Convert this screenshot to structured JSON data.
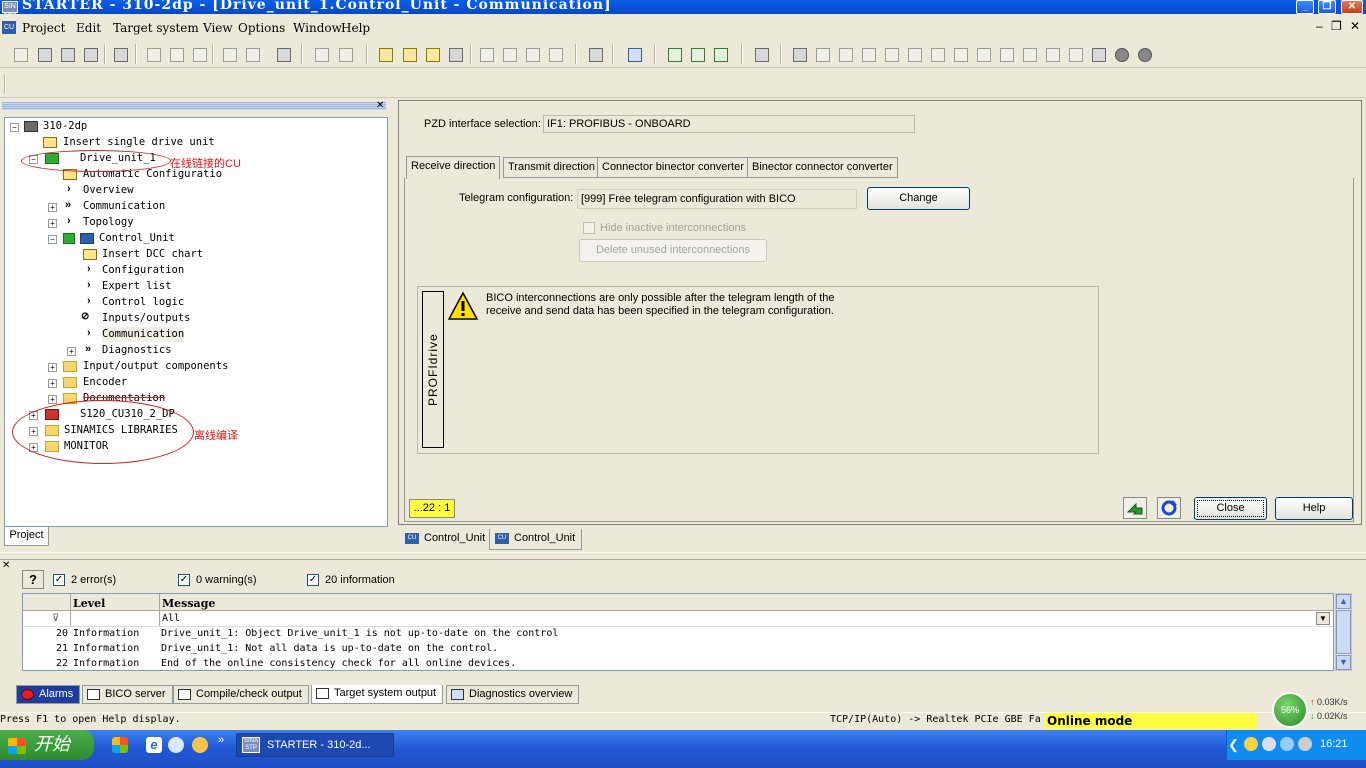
{
  "window": {
    "title": "STARTER - 310-2dp - [Drive_unit_1.Control_Unit - Communication]",
    "app_icon": "SIN STP"
  },
  "menu": [
    "Project",
    "Edit",
    "Target system",
    "View",
    "Options",
    "Window",
    "Help"
  ],
  "project_tree": {
    "nodes": [
      {
        "label": "310-2dp"
      },
      {
        "label": "Insert single drive unit"
      },
      {
        "label": "Drive_unit_1"
      },
      {
        "label": "Automatic Configuration"
      },
      {
        "label": "Overview"
      },
      {
        "label": "Communication"
      },
      {
        "label": "Topology"
      },
      {
        "label": "Control_Unit"
      },
      {
        "label": "Insert DCC chart"
      },
      {
        "label": "Configuration"
      },
      {
        "label": "Expert list"
      },
      {
        "label": "Control logic"
      },
      {
        "label": "Inputs/outputs"
      },
      {
        "label": "Communication"
      },
      {
        "label": "Diagnostics"
      },
      {
        "label": "Input/output components"
      },
      {
        "label": "Encoder"
      },
      {
        "label": "Documentation"
      },
      {
        "label": "S120_CU310_2_DP"
      },
      {
        "label": "SINAMICS LIBRARIES"
      },
      {
        "label": "MONITOR"
      }
    ],
    "annotation_online": "在线链接的CU",
    "annotation_offline": "离线编译",
    "tab_label": "Project"
  },
  "communication": {
    "pzd_label": "PZD interface selection:",
    "pzd_value": "IF1:  PROFIBUS - ONBOARD",
    "tabs": [
      "Receive direction",
      "Transmit direction",
      "Connector binector converter",
      "Binector connector converter"
    ],
    "telegram_label": "Telegram configuration:",
    "telegram_value": "[999] Free telegram configuration with BICO",
    "change_label": "Change",
    "hide_label": "Hide inactive interconnections",
    "delete_label": "Delete unused interconnections",
    "profidrive_label": "PROFIdrive",
    "warning_text": "BICO interconnections are only possible after the telegram length of the receive and send data has been specified in the telegram configuration.",
    "status_value": "...22 : 1",
    "close_label": "Close",
    "help_label": "Help"
  },
  "workbench_tabs": [
    {
      "label": "Control_Unit",
      "icon": "cu-icon"
    },
    {
      "label": "Control_Unit",
      "icon": "cu-icon"
    }
  ],
  "output": {
    "errors": "2 error(s)",
    "warnings": "0 warning(s)",
    "info": "20 information",
    "columns": [
      "Level",
      "Message"
    ],
    "filter_value": "All",
    "rows": [
      {
        "num": "20",
        "level": "Information",
        "message": "Drive_unit_1: Object Drive_unit_1 is not up-to-date on the control"
      },
      {
        "num": "21",
        "level": "Information",
        "message": "Drive_unit_1: Not all data is up-to-date on the control."
      },
      {
        "num": "22",
        "level": "Information",
        "message": "End of the online consistency check for all online devices."
      }
    ],
    "tabs": [
      "Alarms",
      "BICO server",
      "Compile/check output",
      "Target system output",
      "Diagnostics overview"
    ]
  },
  "status_bar": {
    "help_text": "Press F1 to open Help display.",
    "connection": "TCP/IP(Auto) -> Realtek PCIe GBE Fa",
    "mode": "Online mode",
    "net_percent": "56%",
    "net_up": "0.03K/s",
    "net_down": "0.02K/s"
  },
  "taskbar": {
    "start_label": "开始",
    "task_label": "STARTER - 310-2d...",
    "task_icon_text": "SINA STP",
    "clock": "16:21"
  },
  "colors": {
    "status_yellow": "#ffff40",
    "annotation_red": "#e01010",
    "taskbar_blue": "#2257d4"
  }
}
